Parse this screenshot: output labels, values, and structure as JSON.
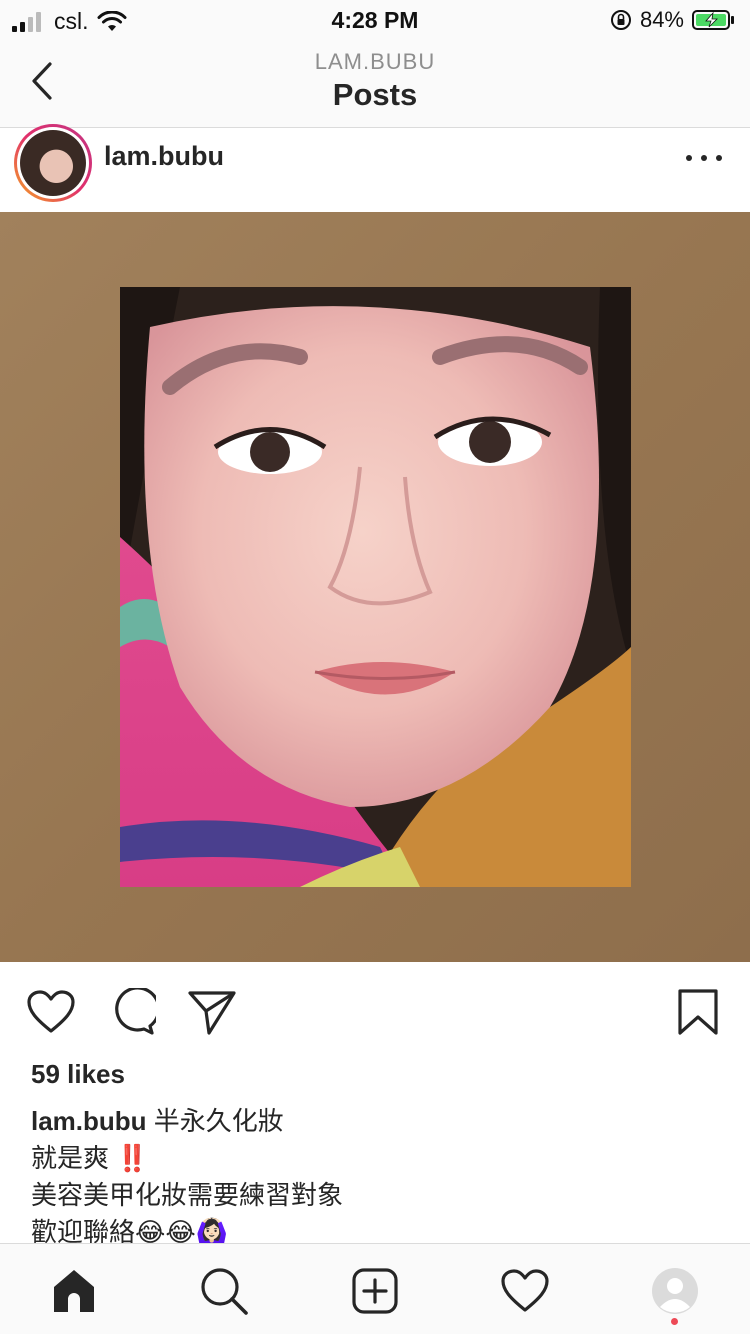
{
  "status_bar": {
    "carrier": "csl.",
    "time": "4:28 PM",
    "battery": "84%"
  },
  "header": {
    "subtitle": "LAM.BUBU",
    "title": "Posts"
  },
  "post": {
    "username": "lam.bubu",
    "likes": "59 likes",
    "caption_lines": [
      "半永久化妝",
      "就是爽",
      "美容美甲化妝需要練習對象",
      "歡迎聯絡"
    ],
    "emoji": {
      "double_exclamation": "‼️",
      "laughing": "😂",
      "gesture": "🙆🏻‍♀️"
    }
  },
  "icons": {
    "back": "chevron-left-icon",
    "more": "more-options-icon",
    "like": "heart-icon",
    "comment": "comment-icon",
    "share": "send-icon",
    "save": "bookmark-icon",
    "home": "home-icon",
    "search": "search-icon",
    "create": "add-post-icon",
    "activity": "heart-icon",
    "profile": "profile-avatar-icon"
  },
  "colors": {
    "accent_red": "#ed4956",
    "battery_green": "#4cd964"
  }
}
